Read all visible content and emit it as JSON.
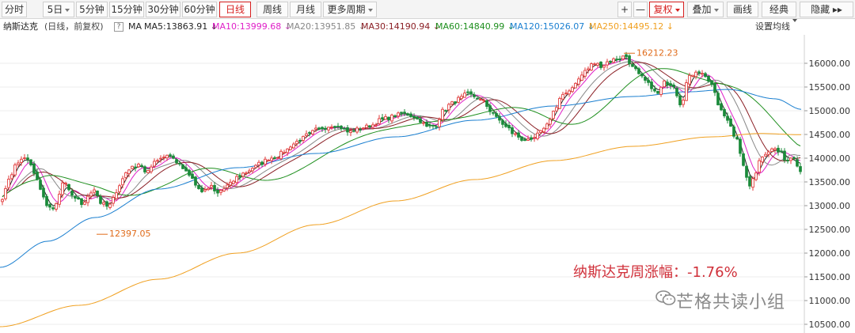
{
  "toolbar": {
    "tabs": [
      {
        "label": "分时"
      },
      {
        "label": "5日",
        "caret": true
      },
      {
        "label": "5分钟"
      },
      {
        "label": "15分钟"
      },
      {
        "label": "30分钟"
      },
      {
        "label": "60分钟"
      },
      {
        "label": "日线",
        "active": true
      },
      {
        "label": "周线"
      },
      {
        "label": "月线"
      },
      {
        "label": "更多周期",
        "caret": true
      }
    ],
    "right": [
      {
        "label": "+"
      },
      {
        "label": "—"
      },
      {
        "label": "复权",
        "active": true,
        "caret": true
      },
      {
        "label": "叠加",
        "caret": true
      },
      {
        "label": "画线"
      },
      {
        "label": "经典"
      },
      {
        "label": "隐藏 ▸▸"
      }
    ]
  },
  "legend": {
    "name": "纳斯达克",
    "mode": "(日线，前复权)",
    "help": "?",
    "ma_label": "MA",
    "items": [
      {
        "label": "MA5:13863.91",
        "arrow": "↓",
        "color": "#222222"
      },
      {
        "label": "MA10:13999.68",
        "arrow": "↓",
        "color": "#e020c8"
      },
      {
        "label": "MA20:13951.85",
        "arrow": "↓",
        "color": "#888888"
      },
      {
        "label": "MA30:14190.94",
        "arrow": "↓",
        "color": "#8a1e24"
      },
      {
        "label": "MA60:14840.99",
        "arrow": "↓",
        "color": "#1e8f1e"
      },
      {
        "label": "MA120:15026.07",
        "arrow": "↓",
        "color": "#1a7fd0"
      },
      {
        "label": "MA250:14495.12",
        "arrow": "↓",
        "color": "#f0a020"
      }
    ],
    "settings": "设置均线"
  },
  "chart_data": {
    "type": "candlestick",
    "ylim": [
      10350,
      16500
    ],
    "y_ticks": [
      10500,
      11000,
      11500,
      12000,
      12500,
      13000,
      13500,
      14000,
      14500,
      15000,
      15500,
      16000
    ],
    "colors": {
      "up": "#e23a3a",
      "down": "#1b8a3a"
    },
    "annotations": [
      {
        "label": "16212.23",
        "value": 16212.23,
        "kind": "high"
      },
      {
        "label": "12397.05",
        "value": 12397.05,
        "kind": "low"
      }
    ],
    "close_anchors": [
      [
        0,
        13050
      ],
      [
        6,
        13300
      ],
      [
        12,
        13600
      ],
      [
        20,
        13850
      ],
      [
        28,
        14000
      ],
      [
        36,
        13950
      ],
      [
        44,
        13650
      ],
      [
        52,
        13300
      ],
      [
        60,
        13000
      ],
      [
        66,
        12900
      ],
      [
        72,
        13100
      ],
      [
        80,
        13500
      ],
      [
        88,
        13300
      ],
      [
        96,
        13150
      ],
      [
        104,
        13000
      ],
      [
        112,
        13200
      ],
      [
        120,
        13300
      ],
      [
        128,
        13050
      ],
      [
        136,
        13000
      ],
      [
        144,
        13200
      ],
      [
        152,
        13450
      ],
      [
        160,
        13700
      ],
      [
        168,
        13800
      ],
      [
        176,
        13900
      ],
      [
        184,
        13700
      ],
      [
        192,
        13850
      ],
      [
        200,
        14000
      ],
      [
        210,
        14050
      ],
      [
        218,
        14000
      ],
      [
        226,
        13900
      ],
      [
        234,
        13750
      ],
      [
        242,
        13600
      ],
      [
        250,
        13350
      ],
      [
        258,
        13300
      ],
      [
        266,
        13400
      ],
      [
        274,
        13250
      ],
      [
        282,
        13350
      ],
      [
        290,
        13450
      ],
      [
        300,
        13600
      ],
      [
        310,
        13700
      ],
      [
        320,
        13800
      ],
      [
        330,
        13900
      ],
      [
        340,
        14000
      ],
      [
        350,
        14050
      ],
      [
        360,
        14150
      ],
      [
        370,
        14300
      ],
      [
        380,
        14400
      ],
      [
        390,
        14500
      ],
      [
        400,
        14600
      ],
      [
        410,
        14650
      ],
      [
        420,
        14700
      ],
      [
        430,
        14650
      ],
      [
        440,
        14550
      ],
      [
        450,
        14600
      ],
      [
        460,
        14650
      ],
      [
        470,
        14700
      ],
      [
        480,
        14800
      ],
      [
        490,
        14850
      ],
      [
        500,
        14900
      ],
      [
        510,
        14950
      ],
      [
        520,
        14900
      ],
      [
        530,
        14800
      ],
      [
        540,
        14650
      ],
      [
        550,
        14700
      ],
      [
        560,
        15000
      ],
      [
        570,
        15150
      ],
      [
        580,
        15250
      ],
      [
        590,
        15350
      ],
      [
        600,
        15300
      ],
      [
        610,
        15200
      ],
      [
        620,
        15000
      ],
      [
        630,
        14800
      ],
      [
        640,
        14650
      ],
      [
        650,
        14500
      ],
      [
        660,
        14400
      ],
      [
        670,
        14350
      ],
      [
        680,
        14500
      ],
      [
        690,
        14700
      ],
      [
        700,
        15000
      ],
      [
        710,
        15300
      ],
      [
        720,
        15450
      ],
      [
        730,
        15650
      ],
      [
        740,
        15850
      ],
      [
        750,
        16000
      ],
      [
        760,
        15950
      ],
      [
        770,
        16050
      ],
      [
        780,
        16100
      ],
      [
        790,
        16150
      ],
      [
        800,
        15900
      ],
      [
        810,
        15700
      ],
      [
        820,
        15550
      ],
      [
        830,
        15350
      ],
      [
        840,
        15600
      ],
      [
        850,
        15550
      ],
      [
        860,
        15150
      ],
      [
        870,
        15700
      ],
      [
        880,
        15850
      ],
      [
        890,
        15750
      ],
      [
        900,
        15500
      ],
      [
        910,
        15000
      ],
      [
        920,
        14800
      ],
      [
        930,
        14400
      ],
      [
        938,
        13900
      ],
      [
        946,
        13400
      ],
      [
        954,
        13700
      ],
      [
        962,
        14050
      ],
      [
        970,
        14150
      ],
      [
        978,
        14200
      ],
      [
        986,
        14100
      ],
      [
        994,
        13950
      ],
      [
        1002,
        14050
      ],
      [
        1008,
        13863
      ],
      [
        1012,
        13700
      ]
    ],
    "ma_series": [
      {
        "name": "MA5",
        "color": "#222222",
        "smooth": 8
      },
      {
        "name": "MA10",
        "color": "#e020c8",
        "smooth": 16
      },
      {
        "name": "MA20",
        "color": "#888888",
        "smooth": 30
      },
      {
        "name": "MA30",
        "color": "#8a1e24",
        "smooth": 45
      },
      {
        "name": "MA60",
        "color": "#1e8f1e",
        "smooth": 85
      },
      {
        "name": "MA120",
        "color": "#1a7fd0",
        "anchors": [
          [
            0,
            11700
          ],
          [
            60,
            12250
          ],
          [
            120,
            12750
          ],
          [
            200,
            13350
          ],
          [
            300,
            13800
          ],
          [
            400,
            14100
          ],
          [
            500,
            14450
          ],
          [
            600,
            14800
          ],
          [
            700,
            15100
          ],
          [
            800,
            15300
          ],
          [
            870,
            15400
          ],
          [
            920,
            15450
          ],
          [
            980,
            15250
          ],
          [
            1012,
            15030
          ]
        ]
      },
      {
        "name": "MA250",
        "color": "#f0a020",
        "anchors": [
          [
            0,
            10450
          ],
          [
            100,
            10900
          ],
          [
            200,
            11450
          ],
          [
            300,
            12000
          ],
          [
            400,
            12600
          ],
          [
            500,
            13100
          ],
          [
            600,
            13550
          ],
          [
            700,
            13950
          ],
          [
            800,
            14250
          ],
          [
            900,
            14450
          ],
          [
            960,
            14520
          ],
          [
            1012,
            14495
          ]
        ]
      }
    ]
  },
  "overlay": {
    "weekly": "纳斯达克周涨幅：-1.76%",
    "watermark": "芒格共读小组"
  }
}
